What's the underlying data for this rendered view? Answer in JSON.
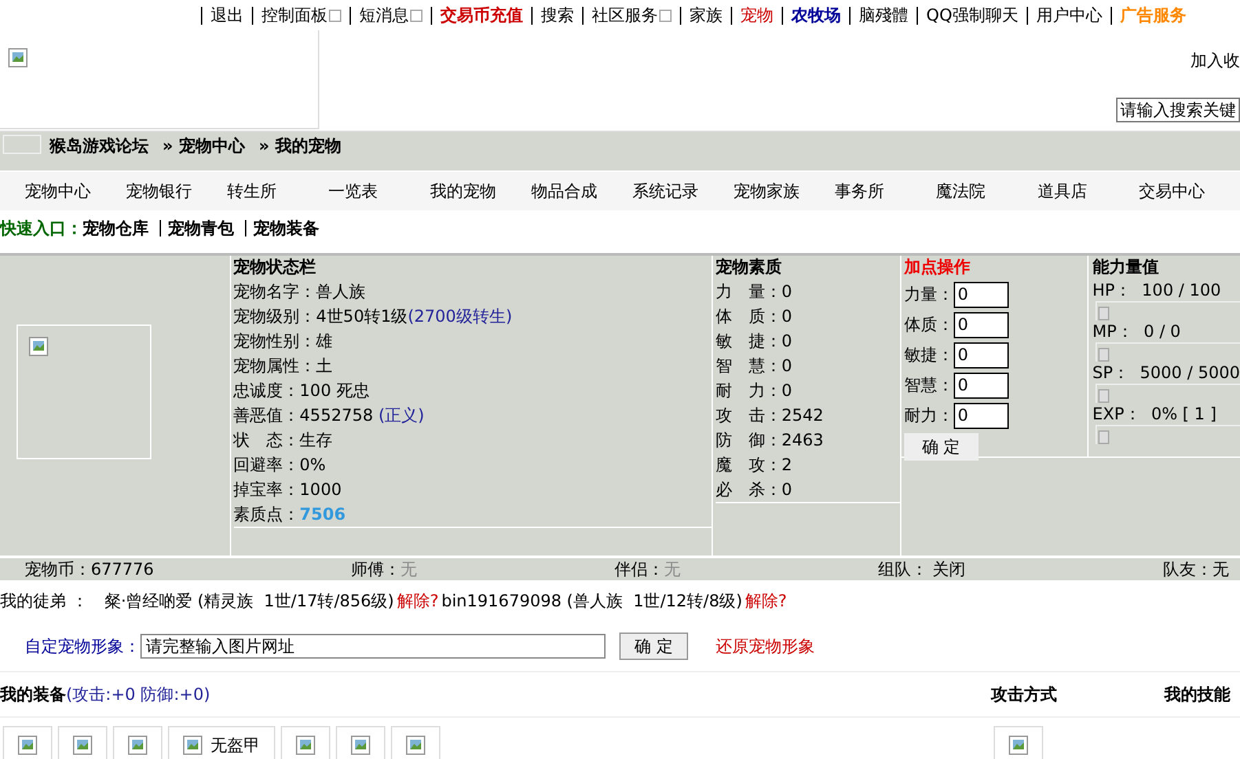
{
  "top_nav": [
    {
      "label": "退出",
      "color": "#000000",
      "bold": false,
      "menu": false
    },
    {
      "label": "控制面板",
      "color": "#000000",
      "bold": false,
      "menu": true
    },
    {
      "label": "短消息",
      "color": "#000000",
      "bold": false,
      "menu": true
    },
    {
      "label": "交易币充值",
      "color": "#cc0000",
      "bold": true,
      "menu": false
    },
    {
      "label": "搜索",
      "color": "#000000",
      "bold": false,
      "menu": false
    },
    {
      "label": "社区服务",
      "color": "#000000",
      "bold": false,
      "menu": true
    },
    {
      "label": "家族",
      "color": "#000000",
      "bold": false,
      "menu": false
    },
    {
      "label": "宠物",
      "color": "#cc0000",
      "bold": false,
      "menu": false
    },
    {
      "label": "农牧场",
      "color": "#000099",
      "bold": true,
      "menu": false
    },
    {
      "label": "脑殘體",
      "color": "#000000",
      "bold": false,
      "menu": false
    },
    {
      "label": "QQ强制聊天",
      "color": "#000000",
      "bold": false,
      "menu": false
    },
    {
      "label": "用户中心",
      "color": "#000000",
      "bold": false,
      "menu": false
    },
    {
      "label": "广告服务",
      "color": "#ff8800",
      "bold": true,
      "menu": false
    }
  ],
  "header": {
    "bookmark_link": "加入收",
    "search": {
      "placeholder": "请输入搜索关键"
    }
  },
  "breadcrumb": [
    "猴岛游戏论坛",
    "» 宠物中心",
    "» 我的宠物"
  ],
  "tabs": [
    "宠物中心",
    "宠物银行",
    "转生所",
    "一览表",
    "我的宠物",
    "物品合成",
    "系统记录",
    "宠物家族",
    "事务所",
    "魔法院",
    "道具店",
    "交易中心"
  ],
  "quick_entry": {
    "label": "快速入口：",
    "links": [
      "宠物仓库",
      "宠物青包",
      "宠物装备"
    ]
  },
  "status": {
    "title": "宠物状态栏",
    "rows": [
      {
        "kind": "plain",
        "label": "宠物名字：",
        "value": "兽人族"
      },
      {
        "kind": "link",
        "label": "宠物级别：",
        "value": "4世50转1级",
        "link": "(2700级转生)"
      },
      {
        "kind": "plain",
        "label": "宠物性别：",
        "value": "雄"
      },
      {
        "kind": "plain",
        "label": "宠物属性：",
        "value": "土"
      },
      {
        "kind": "plain",
        "label": "忠诚度：",
        "value": "100 死忠"
      },
      {
        "kind": "link",
        "label": "善恶值：",
        "value": "4552758 ",
        "link": "(正义)"
      },
      {
        "kind": "plain",
        "label": "状　态：",
        "value": "生存"
      },
      {
        "kind": "plain",
        "label": "回避率：",
        "value": "0%"
      },
      {
        "kind": "plain",
        "label": "掉宝率：",
        "value": "1000"
      },
      {
        "kind": "points",
        "label": "素质点：",
        "value": "7506"
      }
    ]
  },
  "attributes": {
    "title": "宠物素质",
    "rows": [
      {
        "label": "力　量：",
        "value": "0"
      },
      {
        "label": "体　质：",
        "value": "0"
      },
      {
        "label": "敏　捷：",
        "value": "0"
      },
      {
        "label": "智　慧：",
        "value": "0"
      },
      {
        "label": "耐　力：",
        "value": "0"
      },
      {
        "label": "攻　击：",
        "value": "2542"
      },
      {
        "label": "防　御：",
        "value": "2463"
      },
      {
        "label": "魔　攻：",
        "value": "2"
      },
      {
        "label": "必　杀：",
        "value": "0"
      }
    ]
  },
  "add_points": {
    "title": "加点操作",
    "fields": [
      {
        "label": "力量：",
        "value": "0"
      },
      {
        "label": "体质：",
        "value": "0"
      },
      {
        "label": "敏捷：",
        "value": "0"
      },
      {
        "label": "智慧：",
        "value": "0"
      },
      {
        "label": "耐力：",
        "value": "0"
      }
    ],
    "button": "确 定"
  },
  "abilities": {
    "title": "能力量值",
    "rows": [
      "HP：  100 / 100",
      "MP：  0 / 0",
      "SP：  5000 / 5000",
      "EXP：  0% [ 1 ]"
    ]
  },
  "stat_bar": [
    {
      "label": "宠物币：",
      "value": "677776",
      "muted": false
    },
    {
      "label": "师傅：",
      "value": "无",
      "muted": true
    },
    {
      "label": "伴侣：",
      "value": "无",
      "muted": true
    },
    {
      "label": "组队：",
      "value": " 关闭",
      "muted": false
    },
    {
      "label": "队友：",
      "value": "无",
      "muted": false
    }
  ],
  "apprentices": {
    "label": "我的徒弟 ：",
    "items": [
      {
        "text": "粲·曾经啲爱 (精灵族  1世/17转/856级)",
        "action": "解除?"
      },
      {
        "text": "bin191679098 (兽人族  1世/12转/8级)",
        "action": "解除?"
      }
    ]
  },
  "custom_image": {
    "label": "自定宠物形象：",
    "value": "请完整输入图片网址",
    "button": "确 定",
    "reset": "还原宠物形象"
  },
  "equipment": {
    "title": "我的装备",
    "bonus": "(攻击:+0 防御:+0)",
    "attack_mode": "攻击方式",
    "skills": "我的技能",
    "slots": [
      {
        "kind": "image"
      },
      {
        "kind": "image"
      },
      {
        "kind": "image"
      },
      {
        "kind": "named",
        "label": "无盔甲"
      },
      {
        "kind": "image"
      },
      {
        "kind": "image"
      },
      {
        "kind": "image"
      }
    ]
  }
}
